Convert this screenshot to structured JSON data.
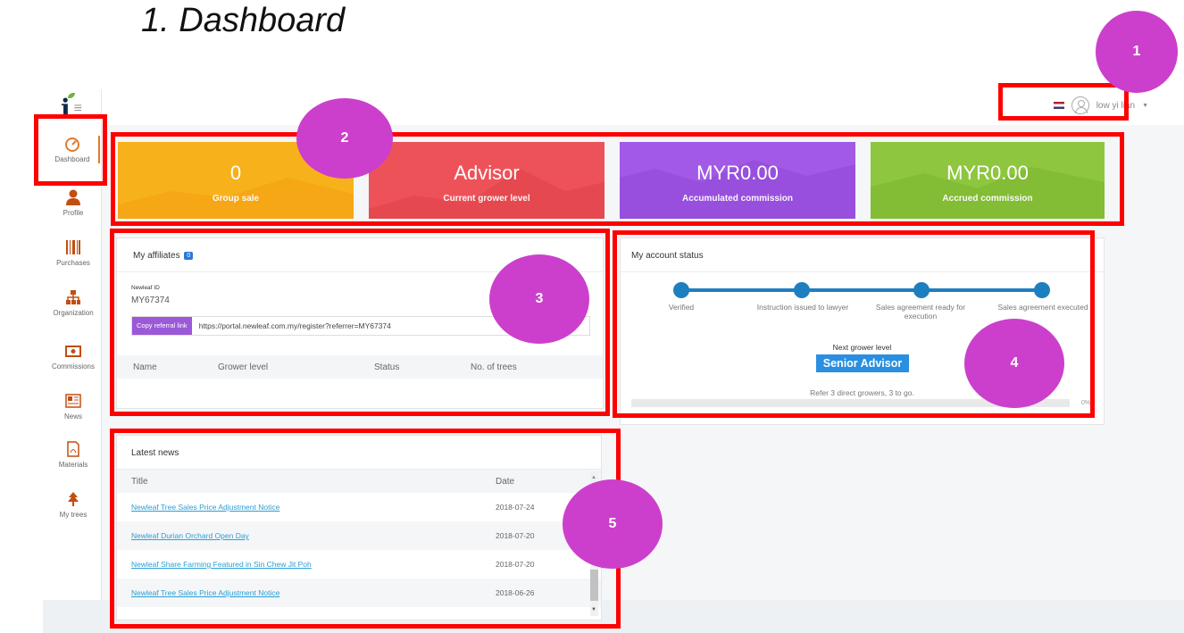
{
  "doc_title": "1. Dashboard",
  "user": {
    "name": "low yi lian"
  },
  "nav": [
    {
      "label": "Dashboard",
      "icon": "dashboard-gauge-icon"
    },
    {
      "label": "Profile",
      "icon": "profile-person-icon"
    },
    {
      "label": "Purchases",
      "icon": "barcode-icon"
    },
    {
      "label": "Organization",
      "icon": "org-chart-icon"
    },
    {
      "label": "Commissions",
      "icon": "money-icon"
    },
    {
      "label": "News",
      "icon": "newspaper-icon"
    },
    {
      "label": "Materials",
      "icon": "pdf-file-icon"
    },
    {
      "label": "My trees",
      "icon": "tree-icon"
    }
  ],
  "stats": [
    {
      "value": "0",
      "label": "Group sale",
      "color": "#f7b21b"
    },
    {
      "value": "Advisor",
      "label": "Current grower level",
      "color": "#ee5259"
    },
    {
      "value": "MYR0.00",
      "label": "Accumulated commission",
      "color": "#a259e6"
    },
    {
      "value": "MYR0.00",
      "label": "Accrued commission",
      "color": "#8ec63f"
    }
  ],
  "affiliates": {
    "title": "My affiliates",
    "count": "0",
    "id_label": "Newleaf ID",
    "id_value": "MY67374",
    "copy_button": "Copy referral link",
    "referral_url": "https://portal.newleaf.com.my/register?referrer=MY67374",
    "columns": [
      "Name",
      "Grower level",
      "Status",
      "No. of trees"
    ]
  },
  "account_status": {
    "title": "My account status",
    "steps": [
      "Verified",
      "Instruction issued to lawyer",
      "Sales agreement ready for execution",
      "Sales agreement executed"
    ],
    "next_level_label": "Next grower level",
    "next_level": "Senior Advisor",
    "refer_text": "Refer 3 direct growers, 3 to go.",
    "progress_percent": "0%",
    "progress": 0
  },
  "news": {
    "title": "Latest news",
    "columns": [
      "Title",
      "Date"
    ],
    "rows": [
      {
        "title": "Newleaf Tree Sales Price Adjustment Notice",
        "date": "2018-07-24"
      },
      {
        "title": "Newleaf Durian Orchard Open Day",
        "date": "2018-07-20"
      },
      {
        "title": "Newleaf Share Farming Featured in Sin Chew Jit Poh",
        "date": "2018-07-20"
      },
      {
        "title": "Newleaf Tree Sales Price Adjustment Notice",
        "date": "2018-06-26"
      }
    ]
  },
  "annotations": [
    "1",
    "2",
    "3",
    "4",
    "5"
  ]
}
